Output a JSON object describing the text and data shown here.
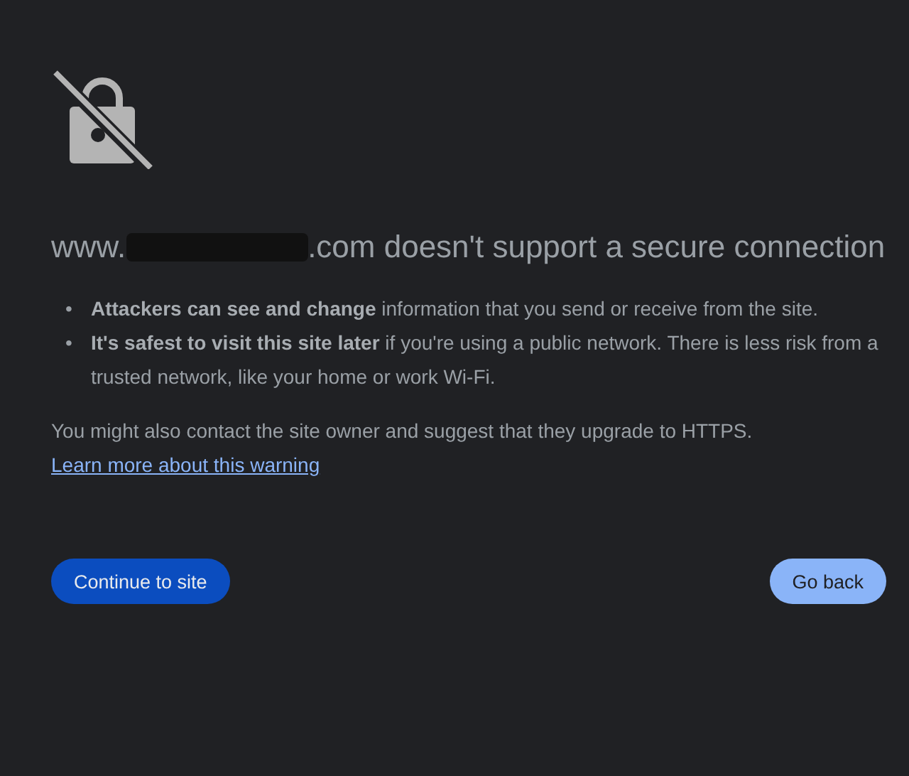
{
  "heading": {
    "before": "www.",
    "redacted": true,
    "after": ".com doesn't support a secure connection"
  },
  "bullets": [
    {
      "marker": "•",
      "text": "**Attackers can see and change** information that you send or receive from the site."
    },
    {
      "marker": "•",
      "text": "**It's safest to visit this site later** if you're using a public network. There is less risk from a trusted network, like your home or work Wi-Fi."
    }
  ],
  "note": {
    "text": "You might also contact the site owner and suggest that they upgrade to HTTPS.",
    "link": "Learn more about this warning"
  },
  "buttons": [
    {
      "label": "Continue to site",
      "kind": "primary"
    },
    {
      "label": "Go back",
      "kind": "secondary"
    }
  ]
}
